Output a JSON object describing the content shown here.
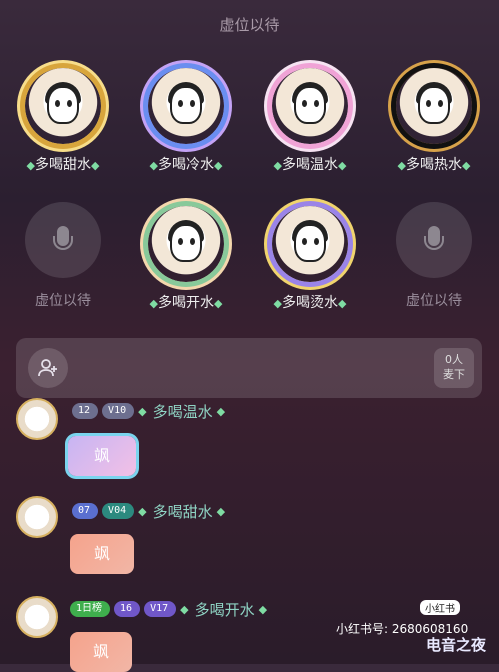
{
  "top_seat_label": "虚位以待",
  "seats_row1": [
    {
      "name": "多喝甜水"
    },
    {
      "name": "多喝冷水"
    },
    {
      "name": "多喝温水"
    },
    {
      "name": "多喝热水"
    }
  ],
  "seats_row2": [
    {
      "name": "虚位以待"
    },
    {
      "name": "多喝开水"
    },
    {
      "name": "多喝烫水"
    },
    {
      "name": "虚位以待"
    }
  ],
  "queue": {
    "count": "0人",
    "action": "麦下"
  },
  "messages": [
    {
      "badge1": "12",
      "badge2": "V10",
      "user": "多喝温水",
      "text": "飒"
    },
    {
      "badge1": "07",
      "badge2": "V04",
      "user": "多喝甜水",
      "text": "飒"
    },
    {
      "badge0": "1日榜",
      "badge1": "16",
      "badge2": "V17",
      "user": "多喝开水",
      "text": "飒"
    }
  ],
  "watermark": {
    "app": "小红书",
    "id": "小红书号: 2680608160",
    "brand": "电音之夜"
  }
}
